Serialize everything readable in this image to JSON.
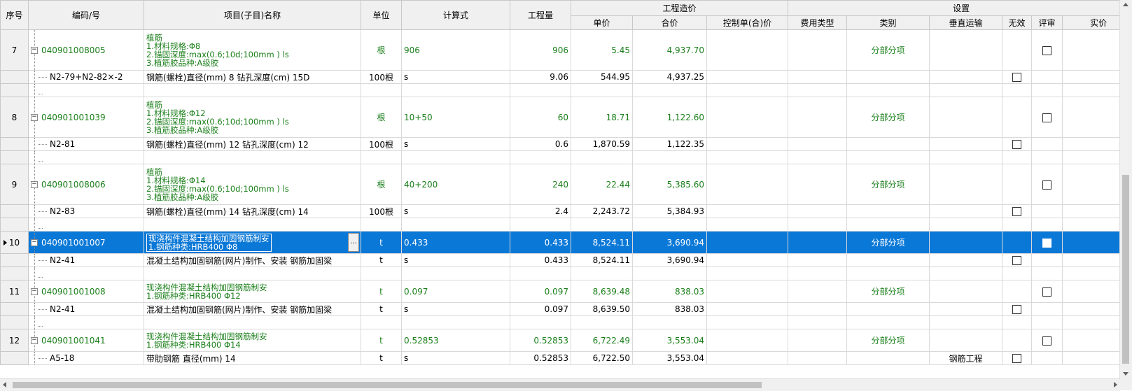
{
  "headers": {
    "seq": "序号",
    "code": "编码/号",
    "name": "项目(子目)名称",
    "unit": "单位",
    "formula": "计算式",
    "qty": "工程量",
    "cost_group": "工程造价",
    "unit_price": "单价",
    "total": "合价",
    "control": "控制单(合)价",
    "settings_group": "设置",
    "fee_type": "费用类型",
    "category": "类别",
    "vertical": "垂直运输",
    "invalid": "无效",
    "review": "评审",
    "actual": "实价"
  },
  "rows": [
    {
      "seq": "7",
      "code": "040901008005",
      "name_lines": [
        "植筋",
        "1.材料规格:Φ8",
        "2.锚固深度:max(0.6;10d;100mm ) ls",
        "3.植筋胶品种:A级胶"
      ],
      "unit": "根",
      "formula": "906",
      "qty": "906",
      "unit_price": "5.45",
      "total": "4,937.70",
      "category": "分部分项",
      "child": {
        "code": "N2-79+N2-82×-2",
        "name": "钢筋(螺栓)直径(mm) 8 钻孔深度(cm) 15D",
        "unit": "100根",
        "formula": "s",
        "qty": "9.06",
        "unit_price": "544.95",
        "total": "4,937.25",
        "vertical": ""
      }
    },
    {
      "seq": "8",
      "code": "040901001039",
      "name_lines": [
        "植筋",
        "1.材料规格:Φ12",
        "2.锚固深度:max(0.6;10d;100mm ) ls",
        "3.植筋胶品种:A级胶"
      ],
      "unit": "根",
      "formula": "10+50",
      "qty": "60",
      "unit_price": "18.71",
      "total": "1,122.60",
      "category": "分部分项",
      "child": {
        "code": "N2-81",
        "name": "钢筋(螺栓)直径(mm) 12 钻孔深度(cm) 12",
        "unit": "100根",
        "formula": "s",
        "qty": "0.6",
        "unit_price": "1,870.59",
        "total": "1,122.35",
        "vertical": ""
      }
    },
    {
      "seq": "9",
      "code": "040901008006",
      "name_lines": [
        "植筋",
        "1.材料规格:Φ14",
        "2.锚固深度:max(0.6;10d;100mm ) ls",
        "3.植筋胶品种:A级胶"
      ],
      "unit": "根",
      "formula": "40+200",
      "qty": "240",
      "unit_price": "22.44",
      "total": "5,385.60",
      "category": "分部分项",
      "child": {
        "code": "N2-83",
        "name": "钢筋(螺栓)直径(mm) 14 钻孔深度(cm) 14",
        "unit": "100根",
        "formula": "s",
        "qty": "2.4",
        "unit_price": "2,243.72",
        "total": "5,384.93",
        "vertical": ""
      }
    },
    {
      "seq": "10",
      "code": "040901001007",
      "name_lines": [
        "现浇构件混凝土结构加固钢筋制安",
        "1.钢筋种类:HRB400 Φ8"
      ],
      "unit": "t",
      "formula": "0.433",
      "qty": "0.433",
      "unit_price": "8,524.11",
      "total": "3,690.94",
      "category": "分部分项",
      "selected": true,
      "child": {
        "code": "N2-41",
        "name": "混凝土结构加固钢筋(网片)制作、安装 钢筋加固梁",
        "unit": "t",
        "formula": "s",
        "qty": "0.433",
        "unit_price": "8,524.11",
        "total": "3,690.94",
        "vertical": ""
      }
    },
    {
      "seq": "11",
      "code": "040901001008",
      "name_lines": [
        "现浇构件混凝土结构加固钢筋制安",
        "1.钢筋种类:HRB400 Φ12"
      ],
      "unit": "t",
      "formula": "0.097",
      "qty": "0.097",
      "unit_price": "8,639.48",
      "total": "838.03",
      "category": "分部分项",
      "child": {
        "code": "N2-41",
        "name": "混凝土结构加固钢筋(网片)制作、安装 钢筋加固梁",
        "unit": "t",
        "formula": "s",
        "qty": "0.097",
        "unit_price": "8,639.50",
        "total": "838.03",
        "vertical": ""
      }
    },
    {
      "seq": "12",
      "code": "040901001041",
      "name_lines": [
        "现浇构件混凝土结构加固钢筋制安",
        "1.钢筋种类:HRB400 Φ14"
      ],
      "unit": "t",
      "formula": "0.52853",
      "qty": "0.52853",
      "unit_price": "6,722.49",
      "total": "3,553.04",
      "category": "分部分项",
      "child": {
        "code": "A5-18",
        "name": "带肋钢筋 直径(mm) 14",
        "unit": "t",
        "formula": "s",
        "qty": "0.52853",
        "unit_price": "6,722.50",
        "total": "3,553.04",
        "vertical": "钢筋工程"
      }
    }
  ]
}
